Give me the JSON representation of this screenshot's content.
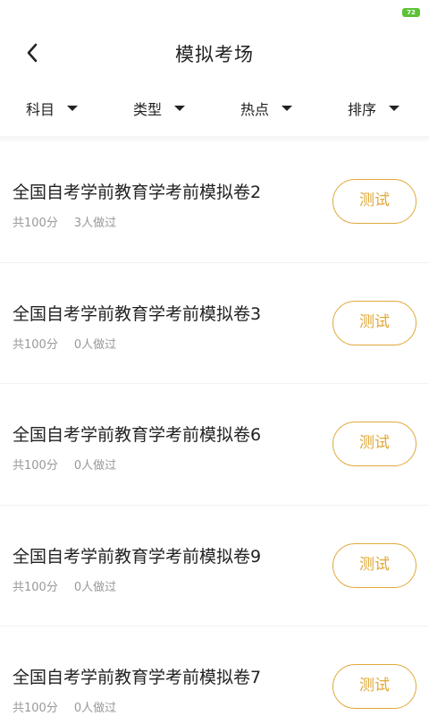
{
  "status_bar": {
    "battery_label": "72",
    "battery_color": "#5bc236"
  },
  "header": {
    "title": "模拟考场",
    "back_icon": "chevron-left-icon"
  },
  "filters": [
    {
      "label": "科目"
    },
    {
      "label": "类型"
    },
    {
      "label": "热点"
    },
    {
      "label": "排序"
    }
  ],
  "items": [
    {
      "title": "全国自考学前教育学考前模拟卷2",
      "score": "共100分",
      "takers": "3人做过",
      "button": "测试"
    },
    {
      "title": "全国自考学前教育学考前模拟卷3",
      "score": "共100分",
      "takers": "0人做过",
      "button": "测试"
    },
    {
      "title": "全国自考学前教育学考前模拟卷6",
      "score": "共100分",
      "takers": "0人做过",
      "button": "测试"
    },
    {
      "title": "全国自考学前教育学考前模拟卷9",
      "score": "共100分",
      "takers": "0人做过",
      "button": "测试"
    },
    {
      "title": "全国自考学前教育学考前模拟卷7",
      "score": "共100分",
      "takers": "0人做过",
      "button": "测试"
    }
  ],
  "colors": {
    "accent": "#e0a93a",
    "meta_text": "#999999",
    "title_text": "#222222"
  }
}
